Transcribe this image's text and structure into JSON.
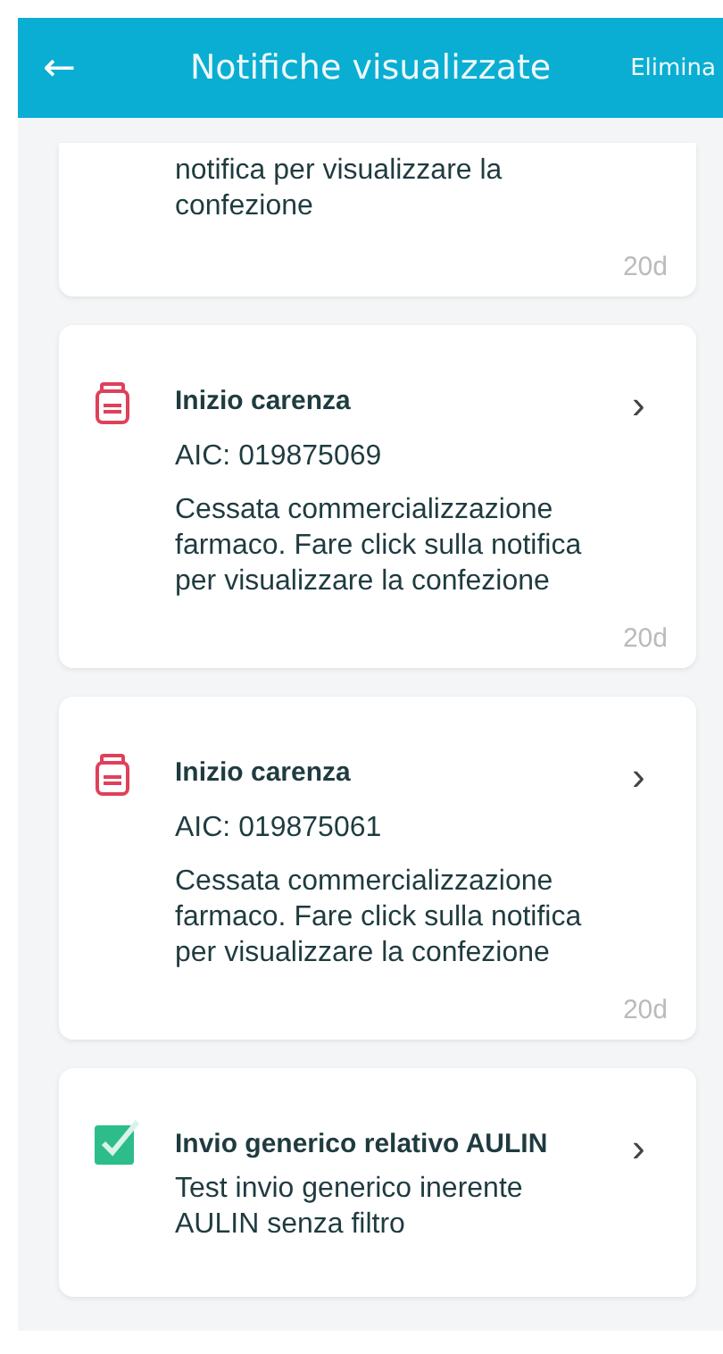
{
  "header": {
    "back_icon": "←",
    "title": "Notifiche visualizzate",
    "action": "Elimina"
  },
  "notifications": [
    {
      "kind": "partial",
      "body": "notifica per visualizzare la confezione",
      "age": "20d"
    },
    {
      "kind": "shortage",
      "title": "Inizio carenza",
      "code": "AIC: 019875069",
      "body": "Cessata commercializzazione farmaco. Fare click sulla notifica per visualizzare la confezione",
      "age": "20d",
      "chevron": "›"
    },
    {
      "kind": "shortage",
      "title": "Inizio carenza",
      "code": "AIC: 019875061",
      "body": "Cessata commercializzazione farmaco. Fare click sulla notifica per visualizzare la confezione",
      "age": "20d",
      "chevron": "›"
    },
    {
      "kind": "generic",
      "title": "Invio generico relativo AULIN",
      "body": "Test invio generico inerente AULIN  senza filtro",
      "chevron": "›"
    }
  ]
}
